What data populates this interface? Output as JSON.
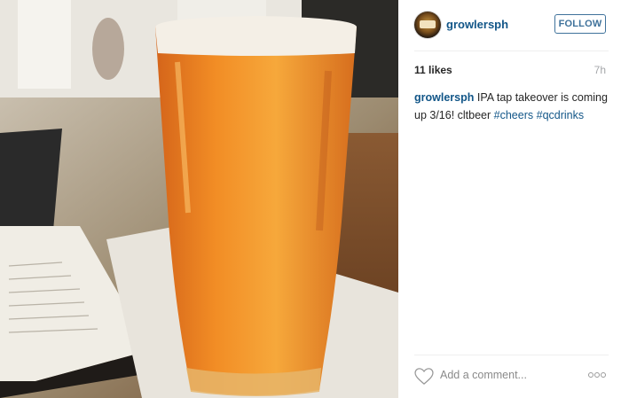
{
  "post": {
    "photo_alt": "A tall glass of amber IPA beer on a wooden bar table",
    "icon_names": [
      "heart-icon",
      "more-options-icon"
    ]
  },
  "header": {
    "username": "growlersph",
    "follow_label": "FOLLOW"
  },
  "stats": {
    "likes": "11 likes",
    "time_ago": "7h"
  },
  "caption": {
    "username": "growlersph",
    "text": " IPA tap takeover is coming up 3/16! cltbeer ",
    "hashtags": [
      "#cheers",
      "#qcdrinks"
    ]
  },
  "comment": {
    "placeholder": "Add a comment..."
  },
  "colors": {
    "link": "#125688",
    "follow_border": "#3f729b",
    "beer": "#e8841f"
  }
}
